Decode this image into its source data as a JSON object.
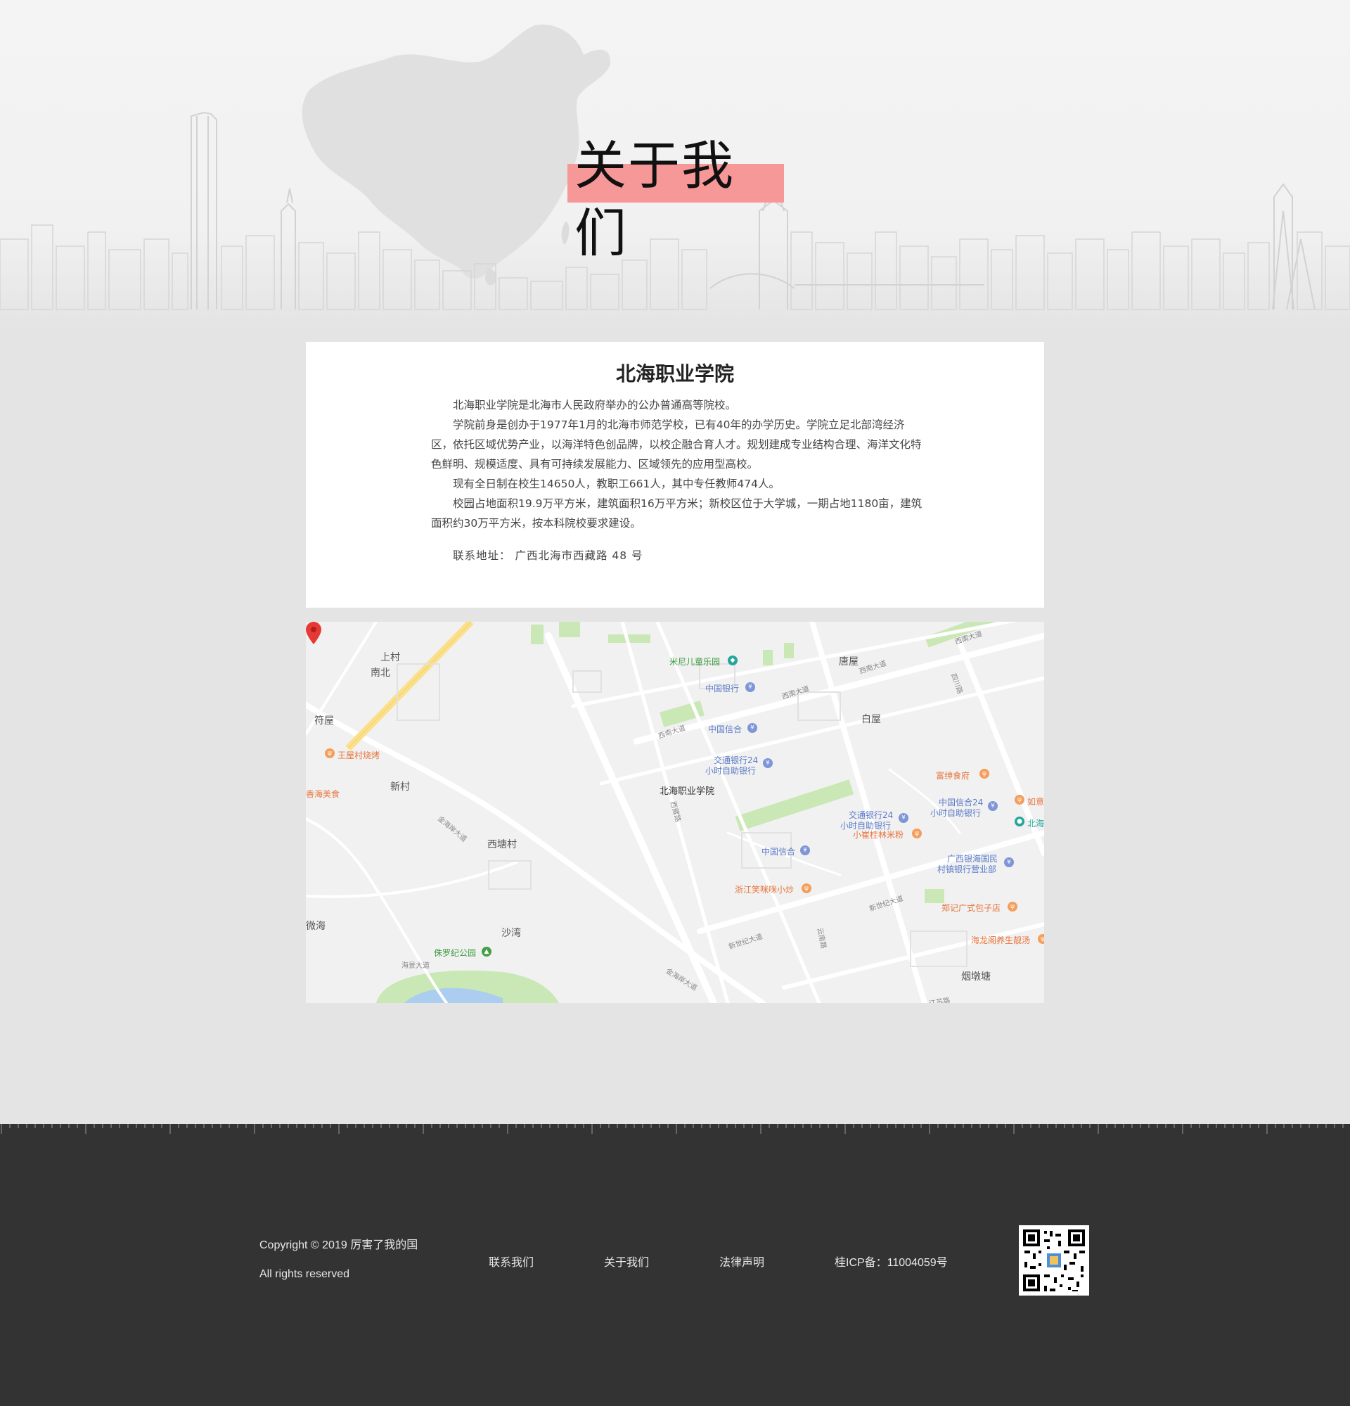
{
  "hero": {
    "title": "关于我们",
    "accent_color": "#f79898"
  },
  "card": {
    "title": "北海职业学院",
    "paragraphs": [
      "北海职业学院是北海市人民政府举办的公办普通高等院校。",
      "学院前身是创办于1977年1月的北海市师范学校，已有40年的办学历史。学院立足北部湾经济区，依托区域优势产业，以海洋特色创品牌，以校企融合育人才。规划建成专业结构合理、海洋文化特色鲜明、规模适度、具有可持续发展能力、区域领先的应用型高校。",
      "现有全日制在校生14650人，教职工661人，其中专任教师474人。",
      "校园占地面积19.9万平方米，建筑面积16万平方米；新校区位于大学城，一期占地1180亩，建筑面积约30万平方米，按本科院校要求建设。"
    ],
    "address_label": "联系地址：",
    "address_value": "广西北海市西藏路 48 号"
  },
  "map": {
    "marker_label": "北海职业学院",
    "places": {
      "shangcun": "上村",
      "nanbei": "南北",
      "fuwu": "符屋",
      "xincun": "新村",
      "xitangcun": "西塘村",
      "shawan": "沙湾",
      "tangwu": "唐屋",
      "baiwu": "白屋",
      "yandunta": "烟墩塘",
      "weihai": "微海"
    },
    "pois": {
      "minier": "米尼儿童乐园",
      "boc1": "中国银行",
      "citic1": "中国信合",
      "bocom1_l1": "交通银行24",
      "bocom1_l2": "小时自助银行",
      "wangwu_bbq": "王屋村烧烤",
      "xianghai": "香海美食",
      "fushen": "富绅食府",
      "citic2_l1": "中国信合24",
      "citic2_l2": "小时自助银行",
      "bocom2_l1": "交通银行24",
      "bocom2_l2": "小时自助银行",
      "xiaocui": "小崔桂林米粉",
      "citic3": "中国信合",
      "guangxi_l1": "广西银海国民",
      "guangxi_l2": "村镇银行营业部",
      "zhejiang": "浙江笑咪咪小炒",
      "zhengji": "郑记广式包子店",
      "hailong": "海龙阁养生靓汤",
      "jurassic": "侏罗纪公园",
      "ruyi": "如意",
      "beihai": "北海"
    },
    "roads": {
      "xinan1": "西南大道",
      "xinan2": "西南大道",
      "xinan3": "西南大道",
      "xinan4": "西南大道",
      "xizang": "西藏路",
      "sichuan": "四川路",
      "xinshiji1": "新世纪大道",
      "xinshiji2": "新世纪大道",
      "jinhaian1": "金海岸大道",
      "jinhaian2": "金海岸大道",
      "haijing": "海景大道",
      "yunnan": "云南路",
      "jiangsu": "江苏路"
    }
  },
  "footer": {
    "copyright": "Copyright © 2019 厉害了我的国",
    "rights": "All rights reserved",
    "links": [
      "联系我们",
      "关于我们",
      "法律声明"
    ],
    "icp": "桂ICP备：11004059号"
  }
}
